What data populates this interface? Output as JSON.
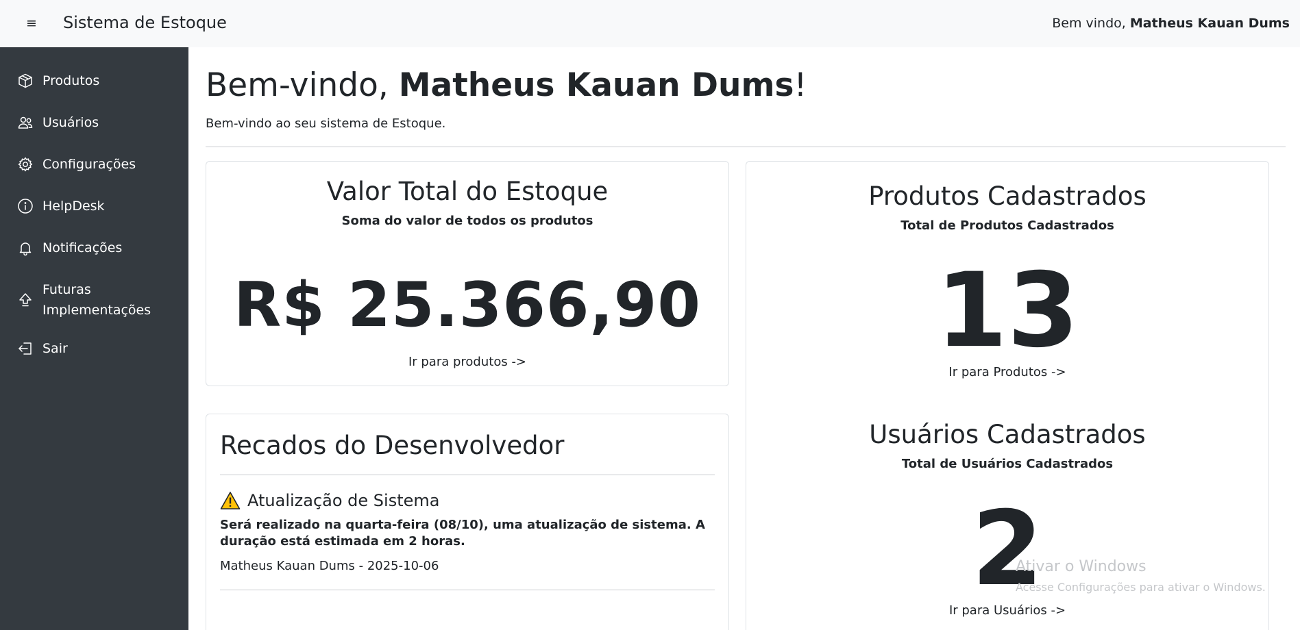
{
  "navbar": {
    "menu_icon": "hamburger-icon",
    "brand": "Sistema de Estoque",
    "welcome_prefix": "Bem vindo, ",
    "user_name": "Matheus Kauan Dums"
  },
  "sidebar": {
    "items": [
      {
        "label": "Produtos",
        "icon": "box-icon"
      },
      {
        "label": "Usuários",
        "icon": "users-icon"
      },
      {
        "label": "Configurações",
        "icon": "gear-icon"
      },
      {
        "label": "HelpDesk",
        "icon": "info-icon"
      },
      {
        "label": "Notificações",
        "icon": "bell-icon"
      },
      {
        "label": "Futuras Implementações",
        "label_line1": "Futuras",
        "label_line2": "Implementações",
        "icon": "upload-icon"
      },
      {
        "label": "Sair",
        "icon": "logout-icon"
      }
    ]
  },
  "main": {
    "title_prefix": "Bem-vindo, ",
    "title_name": "Matheus Kauan Dums",
    "title_suffix": "!",
    "subtitle": "Bem-vindo ao seu sistema de Estoque."
  },
  "valor_card": {
    "title": "Valor Total do Estoque",
    "subtitle": "Soma do valor de todos os produtos",
    "value": "R$ 25.366,90",
    "link": "Ir para produtos ->"
  },
  "recados": {
    "title": "Recados do Desenvolvedor",
    "items": [
      {
        "icon": "warning-icon",
        "title": "Atualização de Sistema",
        "body": "Será realizado na quarta-feira (08/10), uma atualização de sistema. A duração está estimada em 2 horas.",
        "meta": "Matheus Kauan Dums - 2025-10-06"
      }
    ]
  },
  "stats": {
    "produtos": {
      "title": "Produtos Cadastrados",
      "subtitle": "Total de Produtos Cadastrados",
      "value": "13",
      "link": "Ir para Produtos ->"
    },
    "usuarios": {
      "title": "Usuários Cadastrados",
      "subtitle": "Total de Usuários Cadastrados",
      "value": "2",
      "link": "Ir para Usuários ->"
    }
  },
  "watermark": {
    "line1": "Ativar o Windows",
    "line2": "Acesse Configurações para ativar o Windows."
  },
  "colors": {
    "sidebar_bg": "#343a40",
    "navbar_bg": "#f8f9fa",
    "text": "#212529",
    "warning": "#ffc107"
  }
}
